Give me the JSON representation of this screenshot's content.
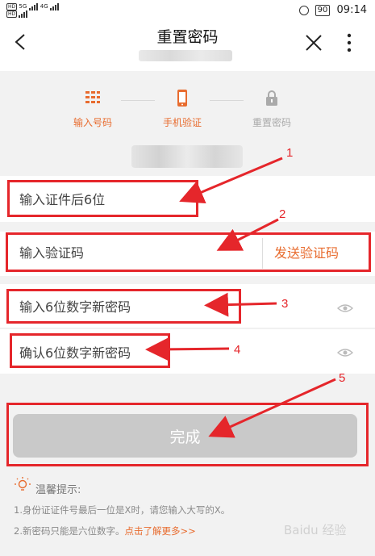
{
  "statusbar": {
    "left_hd1": "HD",
    "left_5g": "5G",
    "left_4g": "4G",
    "left_hd2": "HD",
    "battery": "90",
    "time": "09:14"
  },
  "navbar": {
    "title": "重置密码"
  },
  "steps": [
    {
      "label": "输入号码",
      "state": "done",
      "color": "#e86c2f"
    },
    {
      "label": "手机验证",
      "state": "active",
      "color": "#e86c2f"
    },
    {
      "label": "重置密码",
      "state": "pending",
      "color": "#aaaaaa"
    }
  ],
  "form": {
    "id_last6_placeholder": "输入证件后6位",
    "code_placeholder": "输入验证码",
    "send_code_label": "发送验证码",
    "new_pwd_placeholder": "输入6位数字新密码",
    "confirm_pwd_placeholder": "确认6位数字新密码"
  },
  "done_button": "完成",
  "tips": {
    "title": "温馨提示:",
    "line1": "1.身份证证件号最后一位是X时，请您输入大写的X。",
    "line2_text": "2.新密码只能是六位数字。",
    "line2_link": "点击了解更多>>"
  },
  "annotations": [
    "1",
    "2",
    "3",
    "4",
    "5"
  ],
  "watermark": "Baidu 经验",
  "colors": {
    "accent": "#e86c2f",
    "annotation_red": "#e5262b",
    "button_disabled": "#c9c9c9"
  }
}
